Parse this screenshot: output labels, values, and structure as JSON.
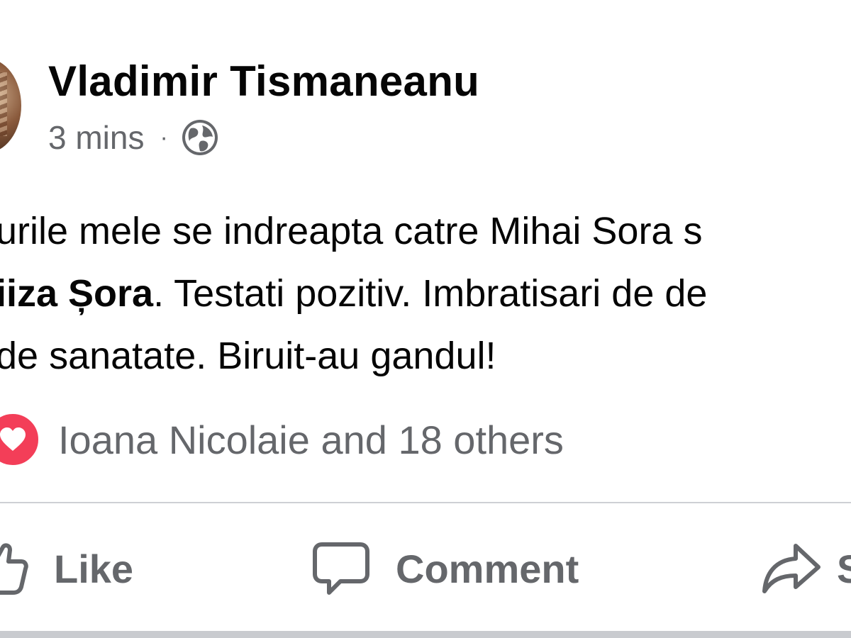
{
  "post": {
    "author": "Vladimir Tismaneanu",
    "time": "3 mins",
    "separator": "·",
    "privacy_icon": "globe-icon",
    "text_lines": [
      {
        "before": "urile mele se indreapta catre Mihai Sora s",
        "bold": "",
        "after": ""
      },
      {
        "before": "",
        "bold": "iiza Șora",
        "after": ". Testati pozitiv. Imbratisari de de"
      },
      {
        "before": "",
        "bold": "",
        "after": "de sanatate. Biruit-au gandul!"
      }
    ],
    "reactions": {
      "icon": "love-reaction-icon",
      "text": "Ioana Nicolaie and 18 others"
    },
    "actions": {
      "like": "Like",
      "comment": "Comment",
      "share": "S"
    }
  },
  "colors": {
    "text_primary": "#050505",
    "text_secondary": "#65676b",
    "love_red": "#f33e58",
    "divider": "#ced0d4"
  }
}
